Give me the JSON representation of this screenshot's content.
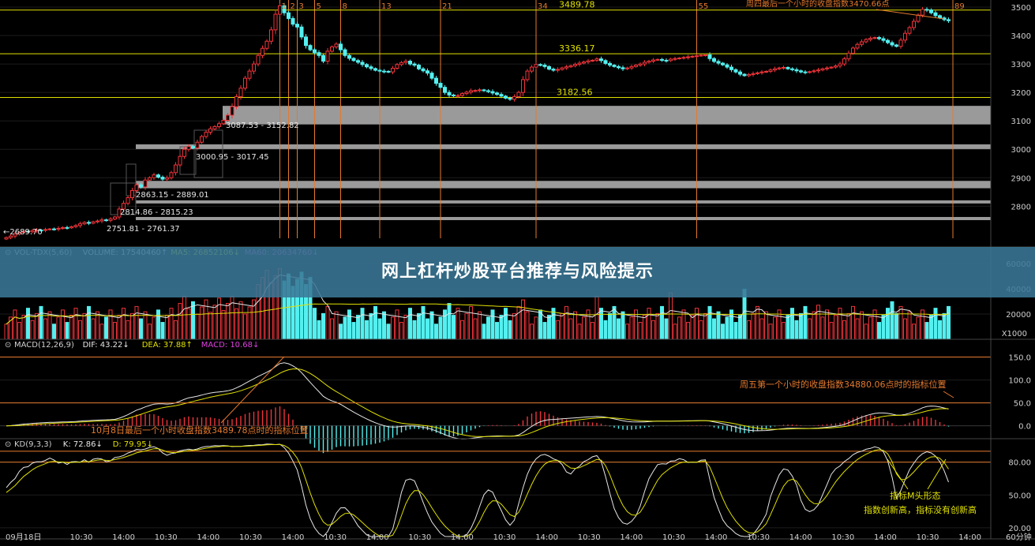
{
  "colors": {
    "background": "#000000",
    "up": "#f0343a",
    "down": "#54f0f0",
    "yellow_line": "#e0e000",
    "orange_line": "#e57a2e",
    "gray_zone": "#9a9a9a",
    "white_line": "#e6e6e6",
    "magenta": "#e040e0",
    "axis_text": "#d0d0d0",
    "banner": "#3a7896"
  },
  "banner": {
    "title": "网上杠杆炒股平台推荐与风险提示"
  },
  "chart_data": [
    {
      "panel": "price",
      "type": "candlestick",
      "ylim": [
        2665,
        3525
      ],
      "yticks": [
        2800,
        2900,
        3000,
        3100,
        3200,
        3300,
        3400,
        3500
      ],
      "grid": true,
      "markers": {
        "start_price": "2689.70"
      },
      "levels": [
        {
          "value": 3489.78,
          "label": "3489.78"
        },
        {
          "value": 3336.17,
          "label": "3336.17"
        },
        {
          "value": 3182.56,
          "label": "3182.56"
        }
      ],
      "gray_zones": [
        {
          "low": 3087.53,
          "high": 3152.82,
          "label": "3087.53 - 3152.82"
        },
        {
          "low": 3000.95,
          "high": 3017.45,
          "label": "3000.95 - 3017.45"
        },
        {
          "low": 2863.15,
          "high": 2889.01,
          "label": "2863.15 - 2889.01"
        },
        {
          "low": 2814.86,
          "high": 2815.23,
          "label": "2814.86 - 2815.23"
        },
        {
          "low": 2751.81,
          "high": 2761.37,
          "label": "2751.81 - 2761.37"
        }
      ],
      "fib_lines": [
        {
          "bar": 63,
          "label": "1"
        },
        {
          "bar": 65,
          "label": "2"
        },
        {
          "bar": 67,
          "label": "3"
        },
        {
          "bar": 71,
          "label": "5"
        },
        {
          "bar": 77,
          "label": "8"
        },
        {
          "bar": 86,
          "label": "13"
        },
        {
          "bar": 100,
          "label": "21"
        },
        {
          "bar": 122,
          "label": "34"
        },
        {
          "bar": 159,
          "label": "55"
        },
        {
          "bar": 218,
          "label": "89"
        }
      ],
      "annotation": "周四最后一个小时的收盘指数3470.66点",
      "closes": [
        2689.7,
        2695,
        2702,
        2708,
        2712,
        2710,
        2714,
        2716,
        2715,
        2718,
        2720,
        2719,
        2722,
        2725,
        2724,
        2728,
        2732,
        2738,
        2743,
        2740,
        2745,
        2748,
        2752,
        2750,
        2755,
        2762,
        2790,
        2810,
        2830,
        2855,
        2875,
        2868,
        2892,
        2900,
        2910,
        2902,
        2895,
        2900,
        2918,
        2945,
        2975,
        3000,
        3010,
        3005,
        3025,
        3045,
        3060,
        3072,
        3080,
        3090,
        3102,
        3120,
        3150,
        3185,
        3215,
        3250,
        3275,
        3300,
        3330,
        3355,
        3380,
        3420,
        3475,
        3505,
        3480,
        3460,
        3440,
        3430,
        3395,
        3365,
        3350,
        3340,
        3330,
        3310,
        3345,
        3360,
        3370,
        3350,
        3330,
        3320,
        3312,
        3306,
        3298,
        3290,
        3284,
        3278,
        3275,
        3274,
        3272,
        3285,
        3298,
        3305,
        3310,
        3300,
        3296,
        3283,
        3276,
        3268,
        3250,
        3232,
        3218,
        3200,
        3191,
        3188,
        3189,
        3196,
        3201,
        3206,
        3207,
        3209,
        3206,
        3203,
        3198,
        3193,
        3187,
        3180,
        3176,
        3185,
        3200,
        3245,
        3275,
        3289,
        3298,
        3296,
        3291,
        3282,
        3278,
        3281,
        3286,
        3290,
        3294,
        3299,
        3303,
        3307,
        3311,
        3313,
        3318,
        3312,
        3302,
        3296,
        3291,
        3287,
        3283,
        3286,
        3291,
        3296,
        3300,
        3306,
        3310,
        3314,
        3316,
        3313,
        3312,
        3317,
        3319,
        3321,
        3323,
        3325,
        3327,
        3329,
        3331,
        3332,
        3319,
        3309,
        3303,
        3297,
        3289,
        3280,
        3272,
        3264,
        3259,
        3263,
        3266,
        3269,
        3272,
        3274,
        3279,
        3283,
        3286,
        3288,
        3283,
        3280,
        3276,
        3272,
        3270,
        3273,
        3276,
        3279,
        3283,
        3286,
        3289,
        3293,
        3300,
        3318,
        3338,
        3356,
        3369,
        3378,
        3386,
        3390,
        3393,
        3389,
        3383,
        3375,
        3367,
        3362,
        3384,
        3408,
        3428,
        3450,
        3472,
        3492,
        3490,
        3480,
        3470,
        3462,
        3456,
        3452
      ]
    },
    {
      "panel": "volume",
      "type": "bar",
      "title": "VOL-TDX(5,60)",
      "items": [
        {
          "label": "VOLUME:",
          "value": "17540460",
          "arrow": "↑"
        },
        {
          "label": "MA5:",
          "value": "26852106",
          "arrow": "↓"
        },
        {
          "label": "MA60:",
          "value": "20634760",
          "arrow": "↓"
        }
      ],
      "ylim": [
        0,
        70000
      ],
      "yticks": [
        20000,
        40000,
        60000
      ],
      "unit": "X1000"
    },
    {
      "panel": "macd",
      "type": "line",
      "title": "MACD(12,26,9)",
      "items": [
        {
          "label": "DIF:",
          "value": "43.22",
          "arrow": "↓"
        },
        {
          "label": "DEA:",
          "value": "37.88",
          "arrow": "↑"
        },
        {
          "label": "MACD:",
          "value": "10.68",
          "arrow": "↓"
        }
      ],
      "ylim": [
        -35,
        175
      ],
      "yticks": [
        0,
        50,
        100,
        150
      ],
      "annotations": [
        "10月8日最后一个小时收盘指数3489.78点时的指标位置",
        "周五第一个小时的收盘指数34880.06点时的指标位置"
      ]
    },
    {
      "panel": "kd",
      "type": "line",
      "title": "KD(9,3,3)",
      "items": [
        {
          "label": "K:",
          "value": "72.86",
          "arrow": "↓"
        },
        {
          "label": "D:",
          "value": "79.95",
          "arrow": "↓"
        }
      ],
      "ylim": [
        12,
        100
      ],
      "yticks": [
        20,
        50,
        80
      ],
      "annotations": [
        "指标M头形态",
        "指数创新高，指标没有创新高"
      ]
    }
  ],
  "time_axis": {
    "labels": [
      "09月18日",
      "10:30",
      "14:00",
      "10:30",
      "14:00",
      "10:30",
      "14:00",
      "10:30",
      "14:00",
      "10:30",
      "14:00",
      "10:30",
      "14:00",
      "10:30",
      "14:00",
      "10:30",
      "14:00",
      "10:30",
      "14:00",
      "10:30",
      "14:00",
      "10:30",
      "14:00"
    ],
    "period": "60分钟"
  }
}
